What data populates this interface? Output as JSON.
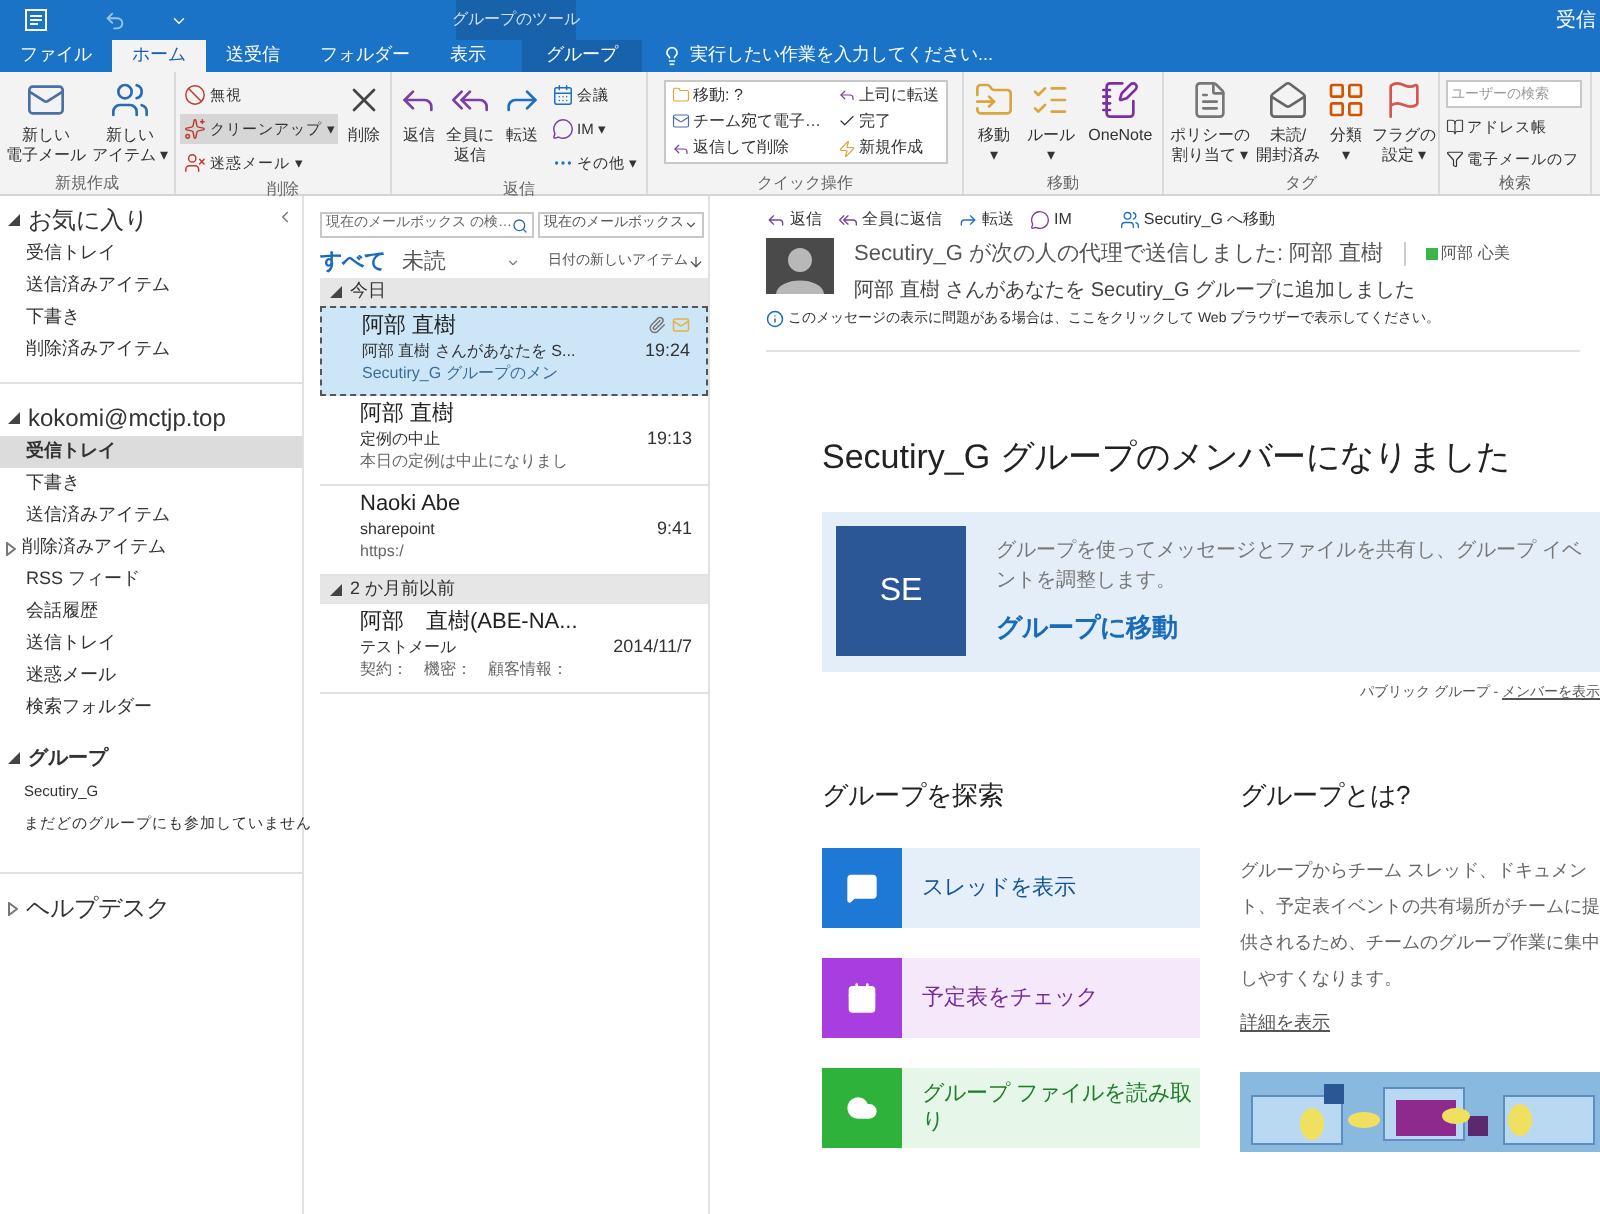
{
  "title_bar": {
    "contextual_label": "グループのツール",
    "right_text": "受信"
  },
  "tabs": [
    {
      "label": "ファイル",
      "selected": false,
      "kind": "normal"
    },
    {
      "label": "ホーム",
      "selected": true,
      "kind": "normal"
    },
    {
      "label": "送受信",
      "selected": false,
      "kind": "normal"
    },
    {
      "label": "フォルダー",
      "selected": false,
      "kind": "normal"
    },
    {
      "label": "表示",
      "selected": false,
      "kind": "normal"
    },
    {
      "label": "グループ",
      "selected": false,
      "kind": "contextual"
    }
  ],
  "tell_me": "実行したい作業を入力してください...",
  "ribbon": [
    {
      "label": "新規作成",
      "items": [
        {
          "kind": "large",
          "lines": [
            "新しい",
            "電子メール"
          ]
        },
        {
          "kind": "large",
          "lines": [
            "新しい",
            "アイテム ▾"
          ]
        }
      ]
    },
    {
      "label": "削除",
      "items": [
        {
          "kind": "stack",
          "buttons": [
            {
              "label": "無視",
              "selected": false
            },
            {
              "label": "クリーンアップ ▾",
              "selected": true
            },
            {
              "label": "迷惑メール ▾",
              "selected": false
            }
          ]
        },
        {
          "kind": "large",
          "lines": [
            "削除"
          ]
        }
      ]
    },
    {
      "label": "返信",
      "items": [
        {
          "kind": "large",
          "lines": [
            "返信"
          ]
        },
        {
          "kind": "large",
          "lines": [
            "全員に",
            "返信"
          ]
        },
        {
          "kind": "large",
          "lines": [
            "転送"
          ]
        },
        {
          "kind": "stack",
          "buttons": [
            {
              "label": "会議",
              "selected": false
            },
            {
              "label": "IM ▾",
              "selected": false
            },
            {
              "label": "その他 ▾",
              "selected": false
            }
          ]
        }
      ]
    },
    {
      "label": "クイック操作",
      "items": [
        {
          "kind": "quicksteps",
          "steps": [
            "移動: ?",
            "チーム宛て電子…",
            "返信して削除",
            "上司に転送",
            "完了",
            "新規作成"
          ]
        }
      ]
    },
    {
      "label": "移動",
      "items": [
        {
          "kind": "large",
          "lines": [
            "移動",
            "▾"
          ]
        },
        {
          "kind": "large",
          "lines": [
            "ルール",
            "▾"
          ]
        },
        {
          "kind": "large",
          "lines": [
            "OneNote"
          ]
        }
      ]
    },
    {
      "label": "タグ",
      "items": [
        {
          "kind": "large",
          "lines": [
            "ポリシーの",
            "割り当て ▾"
          ]
        },
        {
          "kind": "large",
          "lines": [
            "未読/",
            "開封済み"
          ]
        },
        {
          "kind": "large",
          "lines": [
            "分類",
            "▾"
          ]
        },
        {
          "kind": "large",
          "lines": [
            "フラグの",
            "設定 ▾"
          ]
        }
      ]
    },
    {
      "label": "検索",
      "items": [
        {
          "kind": "search",
          "placeholder": "ユーザーの検索",
          "buttons": [
            "アドレス帳",
            "電子メールのフ"
          ]
        }
      ]
    }
  ],
  "nav": [
    {
      "label": "お気に入り",
      "expanded": true,
      "kind": "favorites",
      "children": [
        {
          "label": "受信トレイ",
          "selected": false
        },
        {
          "label": "送信済みアイテム",
          "selected": false
        },
        {
          "label": "下書き",
          "selected": false
        },
        {
          "label": "削除済みアイテム",
          "selected": false
        }
      ]
    },
    {
      "label": "kokomi@mctjp.top",
      "expanded": true,
      "kind": "account",
      "children": [
        {
          "label": "受信トレイ",
          "selected": true
        },
        {
          "label": "下書き",
          "selected": false
        },
        {
          "label": "送信済みアイテム",
          "selected": false
        },
        {
          "label": "削除済みアイテム",
          "selected": false,
          "expanded": false
        },
        {
          "label": "RSS フィード",
          "selected": false
        },
        {
          "label": "会話履歴",
          "selected": false
        },
        {
          "label": "送信トレイ",
          "selected": false
        },
        {
          "label": "迷惑メール",
          "selected": false
        },
        {
          "label": "検索フォルダー",
          "selected": false
        },
        {
          "label": "グループ",
          "expanded": true,
          "kind": "section",
          "children": [
            {
              "label": "Secutiry_G",
              "selected": false
            },
            {
              "label": "まだどのグループにも参加していません",
              "selected": false
            }
          ]
        }
      ]
    },
    {
      "label": "ヘルプデスク",
      "expanded": false,
      "kind": "account"
    }
  ],
  "message_list": {
    "search_placeholder": "現在のメールボックス の検…",
    "scope": "現在のメールボックス",
    "filters": [
      {
        "label": "すべて",
        "selected": true
      },
      {
        "label": "未読",
        "selected": false
      }
    ],
    "sort": "日付の新しいアイテム",
    "groups": [
      {
        "label": "今日",
        "expanded": true,
        "messages": [
          {
            "sender": "阿部 直樹",
            "subject": "阿部 直樹 さんがあなたを S...",
            "preview": "Secutiry_G グループのメン",
            "time": "19:24",
            "selected": true,
            "attachment": true,
            "envelope": true
          },
          {
            "sender": "阿部 直樹",
            "subject": "定例の中止",
            "preview": "本日の定例は中止になりまし",
            "time": "19:13",
            "selected": false,
            "attachment": false,
            "envelope": false
          },
          {
            "sender": "Naoki Abe",
            "subject": "sharepoint",
            "preview": "https:/",
            "time": "9:41",
            "selected": false,
            "attachment": false,
            "envelope": false
          }
        ]
      },
      {
        "label": "2 か月前以前",
        "expanded": true,
        "messages": [
          {
            "sender": "阿部　直樹(ABE-NA...",
            "subject": "テストメール",
            "preview": "契約：　機密：　顧客情報：",
            "time": "2014/11/7",
            "selected": false,
            "attachment": false,
            "envelope": false
          }
        ]
      }
    ]
  },
  "reading_pane": {
    "actions": [
      "返信",
      "全員に返信",
      "転送",
      "IM",
      "Secutiry_G へ移動"
    ],
    "sender_line": "Secutiry_G が次の人の代理で送信しました: 阿部 直樹",
    "recipient": {
      "name": "阿部 心美",
      "color": "#3cb44a"
    },
    "subject": "阿部 直樹 さんがあなたを Secutiry_G グループに追加しました",
    "info": "このメッセージの表示に問題がある場合は、ここをクリックして Web ブラウザーで表示してください。",
    "headline": "Secutiry_G グループのメンバーになりました",
    "card": {
      "initials": "SE",
      "text": "グループを使ってメッセージとファイルを共有し、グループ イベントを調整します。",
      "link": "グループに移動"
    },
    "footer": {
      "text": "パブリック グループ - ",
      "link": "メンバーを表示"
    },
    "explore": {
      "title": "グループを探索",
      "items": [
        {
          "label": "スレッドを表示",
          "kind": "chat",
          "color": "#1e78d6"
        },
        {
          "label": "予定表をチェック",
          "kind": "calendar",
          "color": "#a83ee0"
        },
        {
          "label": "グループ ファイルを読み取り",
          "kind": "cloud",
          "color": "#2fb23c"
        }
      ]
    },
    "about": {
      "title": "グループとは?",
      "text": "グループからチーム スレッド、ドキュメント、予定表イベントの共有場所がチームに提供されるため、チームのグループ作業に集中しやすくなります。",
      "link": "詳細を表示"
    }
  }
}
